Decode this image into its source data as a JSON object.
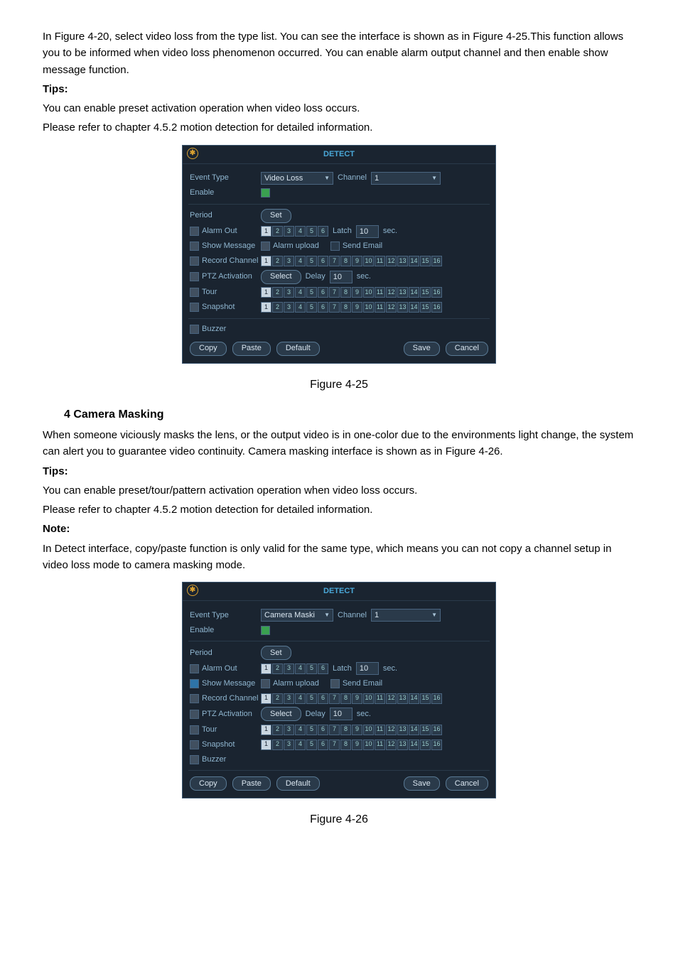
{
  "doc": {
    "p1": "In Figure 4-20, select video loss from the type list. You can see the interface is shown as in Figure 4-25.This function allows you to be informed when video loss phenomenon occurred. You can enable alarm output channel and then enable show message function.",
    "tips": "Tips:",
    "p2": "You can enable preset activation operation when video loss occurs.",
    "p3": "Please refer to chapter 4.5.2 motion detection for detailed information.",
    "caption1": "Figure 4-25",
    "sec4": "4 Camera Masking",
    "p4": "When someone viciously masks the lens, or the output video is in one-color due to the environments light change, the system can alert you to guarantee video continuity. Camera masking interface is shown as in Figure 4-26.",
    "p5": "You can enable preset/tour/pattern activation operation when video loss occurs.",
    "p6": "Please refer to chapter 4.5.2 motion detection for detailed information.",
    "note": "Note:",
    "p7": "In Detect interface, copy/paste function is only valid for the same type, which means you can not copy a channel setup in video loss mode to camera masking mode.",
    "caption2": "Figure 4-26"
  },
  "win_common": {
    "title": "DETECT",
    "event_type": "Event Type",
    "enable": "Enable",
    "channel": "Channel",
    "channel_val": "1",
    "period": "Period",
    "set": "Set",
    "alarm_out": "Alarm Out",
    "latch": "Latch",
    "latch_val": "10",
    "sec": "sec.",
    "show_message": "Show Message",
    "alarm_upload": "Alarm upload",
    "send_email": "Send Email",
    "record_channel": "Record Channel",
    "ptz": "PTZ Activation",
    "select": "Select",
    "delay": "Delay",
    "delay_val": "10",
    "tour": "Tour",
    "snapshot": "Snapshot",
    "buzzer": "Buzzer",
    "copy": "Copy",
    "paste": "Paste",
    "default": "Default",
    "save": "Save",
    "cancel": "Cancel",
    "alarm_out_count": 6,
    "record_count": 16,
    "tour_count": 16,
    "snapshot_count": 16
  },
  "win1": {
    "event_value": "Video Loss"
  },
  "win2": {
    "event_value": "Camera Maski"
  }
}
